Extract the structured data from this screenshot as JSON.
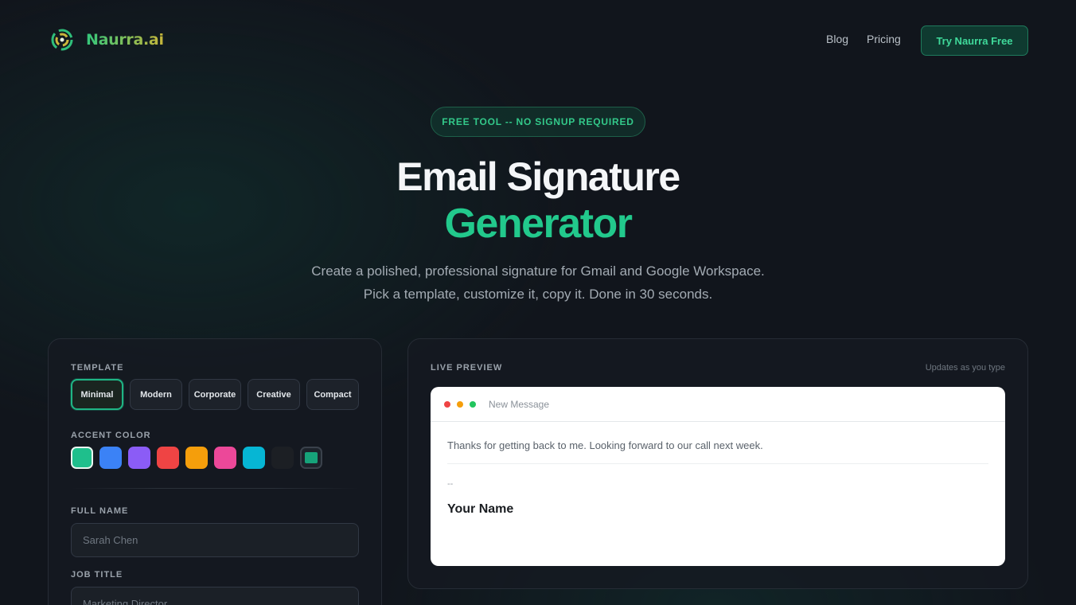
{
  "nav": {
    "brand": "Naurra.ai",
    "links": [
      "Blog",
      "Pricing"
    ],
    "cta": "Try Naurra Free"
  },
  "hero": {
    "badge": "FREE TOOL -- NO SIGNUP REQUIRED",
    "title_line1": "Email Signature",
    "title_line2": "Generator",
    "subtitle": "Create a polished, professional signature for Gmail and Google Workspace. Pick a template, customize it, copy it. Done in 30 seconds."
  },
  "editor": {
    "template_label": "TEMPLATE",
    "templates": [
      "Minimal",
      "Modern",
      "Corporate",
      "Creative",
      "Compact"
    ],
    "selected_template": "Minimal",
    "accent_label": "ACCENT COLOR",
    "accent_colors": [
      "#1fbf8c",
      "#3b82f6",
      "#8b5cf6",
      "#ef4444",
      "#f59e0b",
      "#ec4899",
      "#06b6d4",
      "#1c1f24"
    ],
    "selected_accent": "#1fbf8c",
    "full_name_label": "FULL NAME",
    "full_name_placeholder": "Sarah Chen",
    "job_title_label": "JOB TITLE",
    "job_title_placeholder": "Marketing Director"
  },
  "preview": {
    "label": "LIVE PREVIEW",
    "hint": "Updates as you type",
    "window_title": "New Message",
    "body": "Thanks for getting back to me. Looking forward to our call next week.",
    "separator": "--",
    "name": "Your Name"
  }
}
